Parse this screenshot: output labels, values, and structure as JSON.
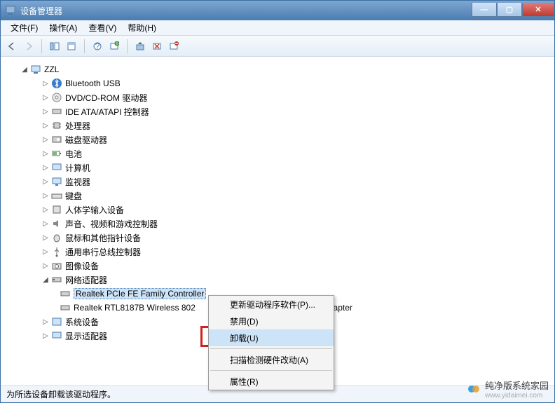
{
  "window": {
    "title": "设备管理器"
  },
  "winbtns": {
    "min": "—",
    "max": "▢",
    "close": "✕"
  },
  "menu": {
    "file": "文件(F)",
    "action": "操作(A)",
    "view": "查看(V)",
    "help": "帮助(H)"
  },
  "tree": {
    "root": "ZZL",
    "n0": "Bluetooth USB",
    "n1": "DVD/CD-ROM 驱动器",
    "n2": "IDE ATA/ATAPI 控制器",
    "n3": "处理器",
    "n4": "磁盘驱动器",
    "n5": "电池",
    "n6": "计算机",
    "n7": "监视器",
    "n8": "键盘",
    "n9": "人体学输入设备",
    "n10": "声音、视频和游戏控制器",
    "n11": "鼠标和其他指针设备",
    "n12": "通用串行总线控制器",
    "n13": "图像设备",
    "n14": "网络适配器",
    "c0": "Realtek PCIe FE Family Controller",
    "c1": "Realtek RTL8187B Wireless 802",
    "c1_tail": "dapter",
    "n15": "系统设备",
    "n16": "显示适配器"
  },
  "context": {
    "update": "更新驱动程序软件(P)...",
    "disable": "禁用(D)",
    "uninstall": "卸载(U)",
    "scan": "扫描检测硬件改动(A)",
    "properties": "属性(R)"
  },
  "status": "为所选设备卸载该驱动程序。",
  "watermark": {
    "text": "纯净版系统家园",
    "url": "www.yidaimei.com"
  },
  "glyph": {
    "tri_right": "▷",
    "tri_down": "▽",
    "tri_open": "◢"
  }
}
